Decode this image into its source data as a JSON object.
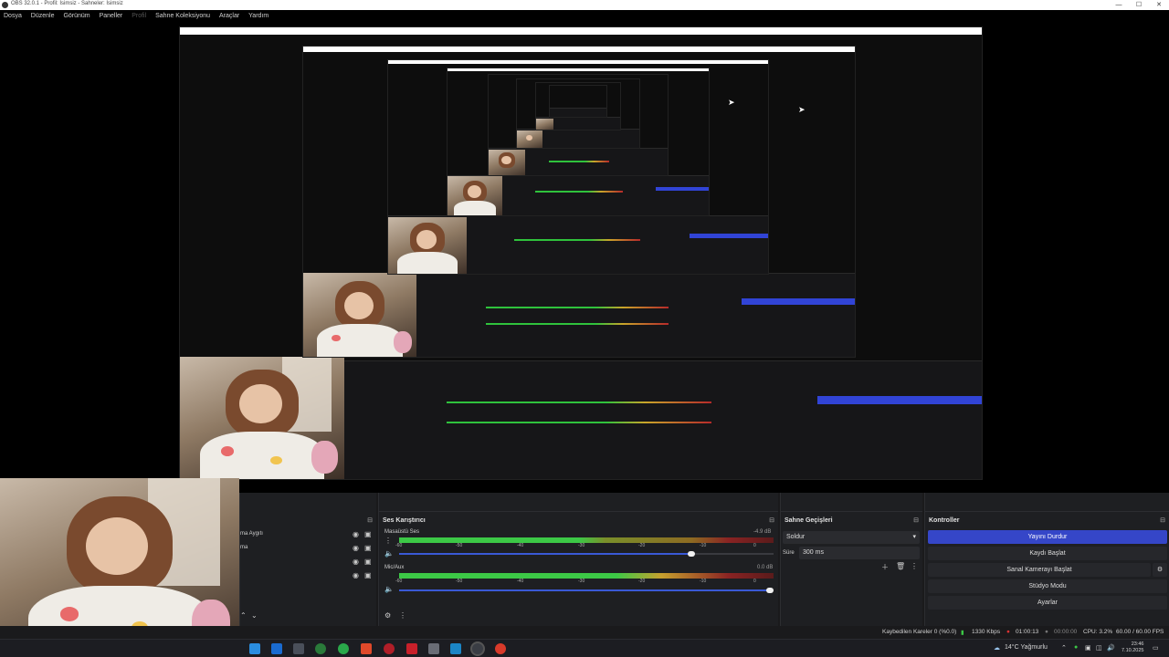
{
  "window": {
    "title": "OBS 32.0.1 - Profil: İsimsiz - Sahneler: İsimsiz",
    "controls": [
      "—",
      "☐",
      "✕"
    ]
  },
  "menu": [
    {
      "label": "Dosya",
      "enabled": true
    },
    {
      "label": "Düzenle",
      "enabled": true
    },
    {
      "label": "Görünüm",
      "enabled": true
    },
    {
      "label": "Paneller",
      "enabled": true
    },
    {
      "label": "Profil",
      "enabled": false
    },
    {
      "label": "Sahne Koleksiyonu",
      "enabled": true
    },
    {
      "label": "Araçlar",
      "enabled": true
    },
    {
      "label": "Yardım",
      "enabled": true
    }
  ],
  "sources": {
    "items": [
      "ma Aygıtı",
      "ma"
    ]
  },
  "audio_mixer": {
    "title": "Ses Karıştırıcı",
    "tracks": [
      {
        "name": "Masaüstü Ses",
        "db": "-4.9 dB",
        "level": 0.55,
        "fader": 0.95
      },
      {
        "name": "Mic/Aux",
        "db": "0.0 dB",
        "level": 0.72,
        "fader": 1.0
      }
    ],
    "scale": [
      "-60",
      "-55",
      "-50",
      "-45",
      "-40",
      "-35",
      "-30",
      "-25",
      "-20",
      "-15",
      "-10",
      "-5",
      "0"
    ]
  },
  "transitions": {
    "title": "Sahne Geçişleri",
    "selected": "Soldur",
    "duration_label": "Süre",
    "duration_value": "300 ms"
  },
  "controls": {
    "title": "Kontroller",
    "buttons": [
      "Yayını Durdur",
      "Kaydı Başlat",
      "Sanal Kamerayı Başlat",
      "Stüdyo Modu",
      "Ayarlar"
    ]
  },
  "status": {
    "dropped": "Kaybedilen Kareler 0 (%0.0)",
    "bitrate": "1330 Kbps",
    "live_time": "01:00:13",
    "rec_time": "00:00:00",
    "cpu": "CPU: 3.2%",
    "fps": "60.00 / 60.00 FPS"
  },
  "taskbar": {
    "weather": "14°C Yağmurlu",
    "time": "23:46",
    "date": "7.10.2025"
  },
  "colors": {
    "accent": "#3546c8",
    "panel": "#1e1f22",
    "meter_green": "#3cc846",
    "meter_red": "#8a2323"
  }
}
